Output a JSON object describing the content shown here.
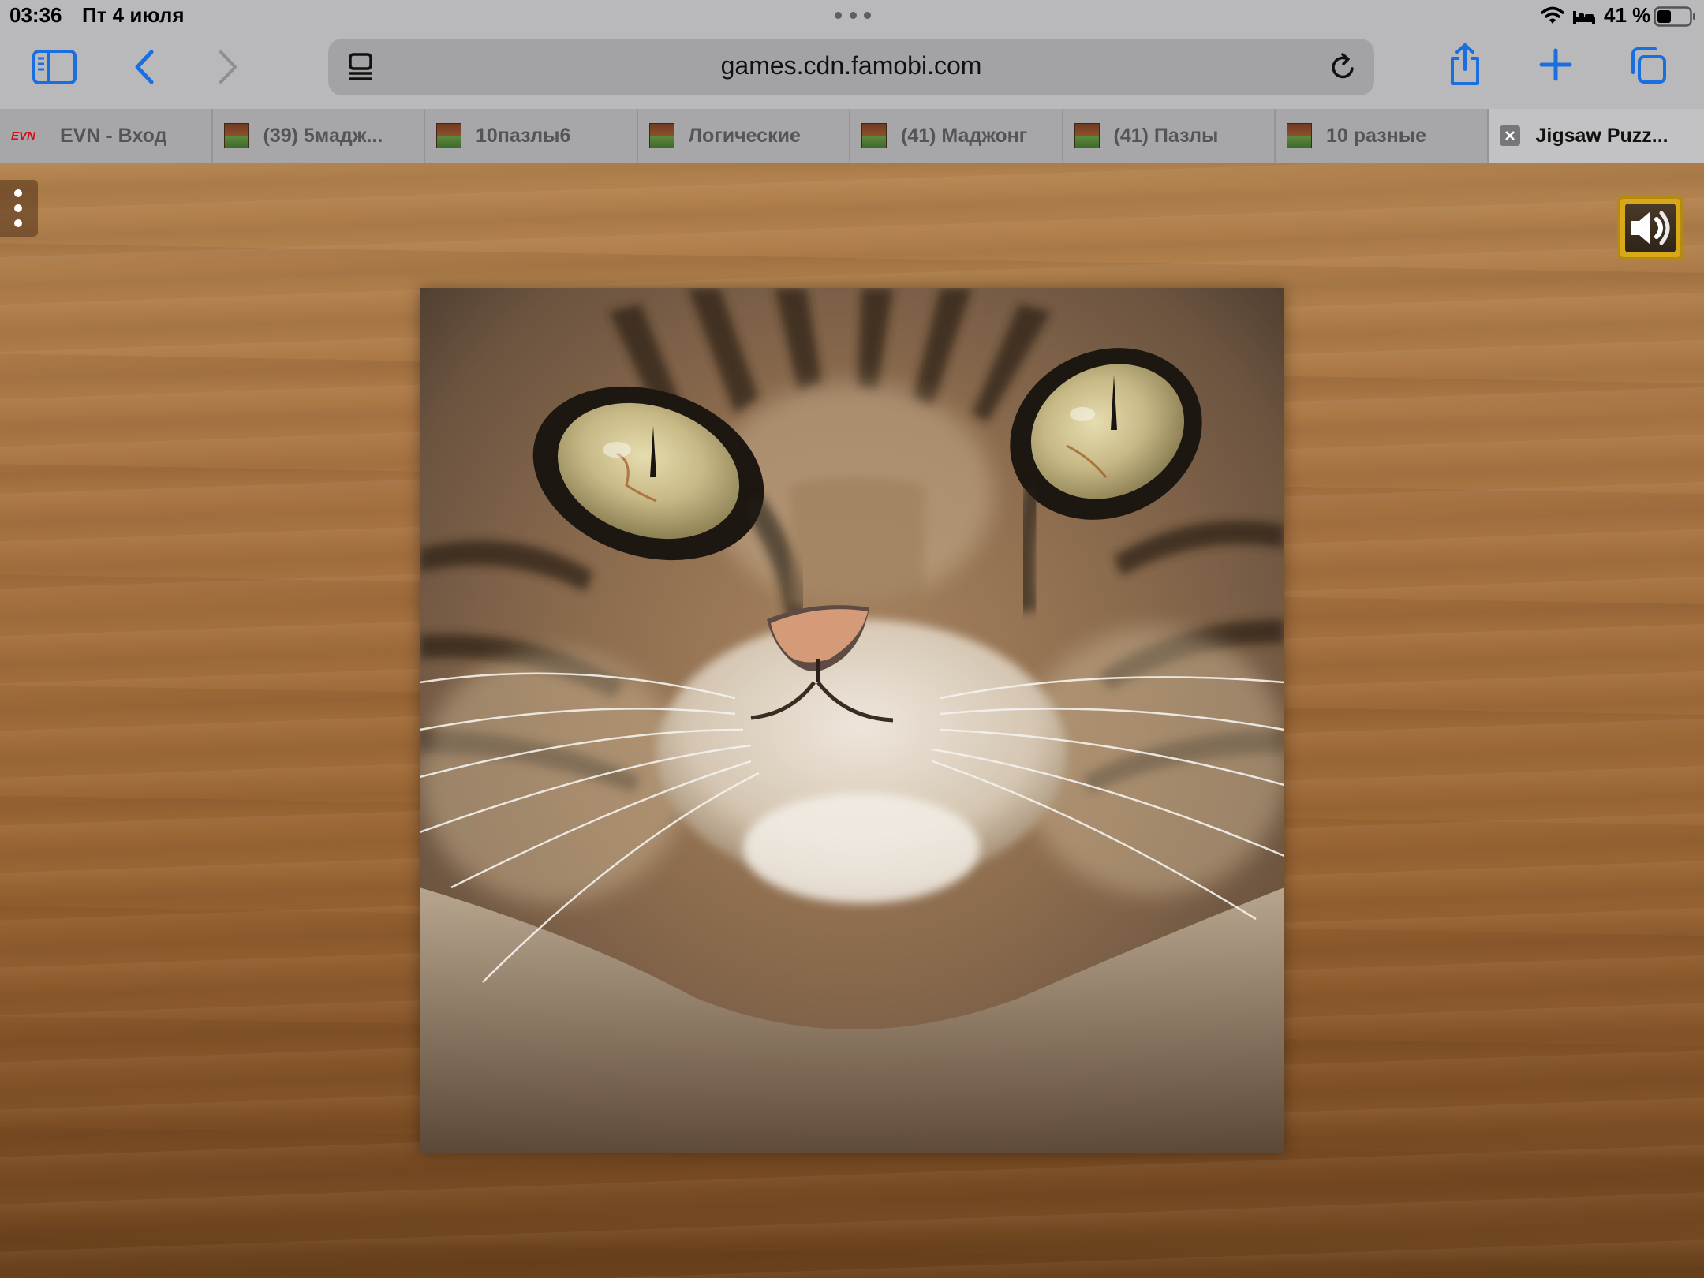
{
  "status_bar": {
    "time": "03:36",
    "date": "Пт 4 июля",
    "battery": "41 %"
  },
  "toolbar": {
    "url": "games.cdn.famobi.com",
    "icons": [
      "sidebar-icon",
      "back-icon",
      "forward-icon",
      "reader-icon",
      "reload-icon",
      "share-icon",
      "plus-icon",
      "tabs-icon"
    ],
    "accent_color": "#1a6fe0"
  },
  "tabs": [
    {
      "favicon": "EVN",
      "title": "EVN - Вход",
      "active": false
    },
    {
      "title": "(39) 5мадж...",
      "active": false
    },
    {
      "title": "10пазлы6",
      "active": false
    },
    {
      "title": "Логические",
      "active": false
    },
    {
      "title": "(41) Маджонг",
      "active": false
    },
    {
      "title": "(41) Пазлы",
      "active": false
    },
    {
      "title": "10 разные",
      "active": false
    },
    {
      "title": "Jigsaw Puzz...",
      "active": true
    }
  ],
  "game": {
    "menu_icon": "more-vertical-icon",
    "sound_icon": "speaker-on-icon",
    "puzzle_subject": "tabby-cat-face-photo"
  }
}
